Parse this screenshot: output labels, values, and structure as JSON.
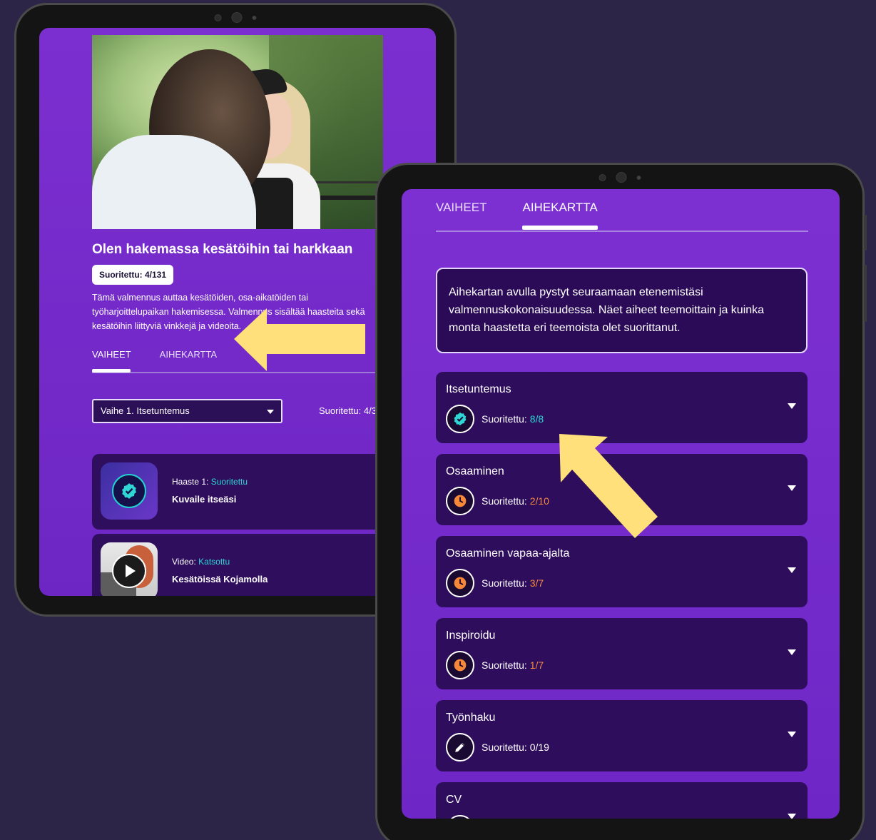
{
  "colors": {
    "background": "#2c2548",
    "screen_purple": "#7c2fd0",
    "card_dark": "#2e0d5d",
    "accent_teal": "#2fd6d3",
    "accent_orange": "#f7883a",
    "arrow_yellow": "#ffe07a"
  },
  "tablet_a": {
    "course_title": "Olen hakemassa kesätöihin tai harkkaan",
    "progress_badge": "Suoritettu: 4/131",
    "description": "Tämä valmennus auttaa kesätöiden, osa-aikatöiden tai työharjoittelupaikan hakemisessa. Valmennus sisältää haasteita sekä kesätöihin liittyviä vinkkejä ja videoita.",
    "tabs": [
      {
        "label": "VAIHEET"
      },
      {
        "label": "AIHEKARTTA"
      }
    ],
    "phase_select": {
      "value": "Vaihe 1. Itsetuntemus",
      "icon": "chevron-down-icon"
    },
    "phase_done": "Suoritettu: 4/3",
    "cards": [
      {
        "kind": "Haaste 1: ",
        "status": "Suoritettu",
        "title": "Kuvaile itseäsi",
        "icon": "check-badge-icon"
      },
      {
        "kind": "Video: ",
        "status": "Katsottu",
        "title": "Kesätöissä Kojamolla",
        "icon": "play-icon"
      }
    ]
  },
  "tablet_b": {
    "tabs": [
      {
        "label": "VAIHEET"
      },
      {
        "label": "AIHEKARTTA"
      }
    ],
    "info_text": "Aihekartan avulla pystyt seuraamaan etenemistäsi valmennuskokonaisuudessa. Näet aiheet teemoittain ja kuinka monta haastetta eri teemoista olet suorittanut.",
    "topics": [
      {
        "name": "Itsetuntemus",
        "label": "Suoritettu: ",
        "value": "8/8",
        "state": "complete",
        "icon": "check-badge-icon"
      },
      {
        "name": "Osaaminen",
        "label": "Suoritettu: ",
        "value": "2/10",
        "state": "in-progress",
        "icon": "clock-icon"
      },
      {
        "name": "Osaaminen vapaa-ajalta",
        "label": "Suoritettu: ",
        "value": "3/7",
        "state": "in-progress",
        "icon": "clock-icon"
      },
      {
        "name": "Inspiroidu",
        "label": "Suoritettu: ",
        "value": "1/7",
        "state": "in-progress",
        "icon": "clock-icon"
      },
      {
        "name": "Työnhaku",
        "label": "Suoritettu: ",
        "value": "0/19",
        "state": "not-started",
        "icon": "pencil-icon"
      },
      {
        "name": "CV",
        "label": "",
        "value": "",
        "state": "not-started",
        "icon": "pencil-icon"
      }
    ]
  }
}
